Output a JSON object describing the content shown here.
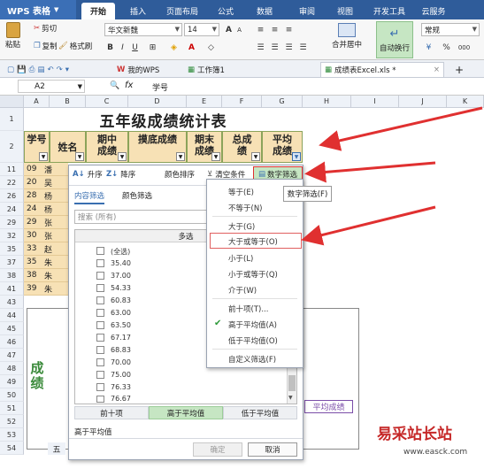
{
  "app": {
    "name": "WPS 表格"
  },
  "ribbon_tabs": [
    "开始",
    "插入",
    "页面布局",
    "公式",
    "数据",
    "审阅",
    "视图",
    "开发工具",
    "云服务"
  ],
  "toolbar": {
    "paste": "粘贴",
    "cut": "剪切",
    "copy": "复制",
    "format_painter": "格式刷",
    "font_name": "华文新魏",
    "font_size": "14",
    "merge_center": "合并居中",
    "wrap_text": "自动换行",
    "number_format": "常规",
    "percent": "%"
  },
  "doc_tabs": [
    {
      "label": "我的WPS"
    },
    {
      "label": "工作簿1"
    },
    {
      "label": "成绩表Excel.xls *"
    }
  ],
  "formula_bar": {
    "cell_ref": "A2",
    "fx": "fx",
    "content": "学号"
  },
  "columns": [
    "A",
    "B",
    "C",
    "D",
    "E",
    "F",
    "G",
    "H",
    "I",
    "J",
    "K"
  ],
  "rows": [
    "1",
    "2",
    "11",
    "22",
    "26",
    "24",
    "29",
    "32",
    "35",
    "37",
    "38",
    "41",
    "43",
    "44",
    "45",
    "46",
    "47",
    "48",
    "49",
    "50",
    "51",
    "52",
    "53",
    "54"
  ],
  "sheet": {
    "title": "五年级成绩统计表",
    "headers": [
      "学号",
      "姓名",
      "期中成绩",
      "摸底成绩",
      "期末成绩",
      "总成绩",
      "平均成绩"
    ],
    "data_rows": [
      {
        "id": "09",
        "name": "潘"
      },
      {
        "id": "20",
        "name": "吴"
      },
      {
        "id": "28",
        "name": "杨"
      },
      {
        "id": "24",
        "name": "杨"
      },
      {
        "id": "29",
        "name": "张"
      },
      {
        "id": "30",
        "name": "张"
      },
      {
        "id": "33",
        "name": "赵"
      },
      {
        "id": "35",
        "name": "朱"
      },
      {
        "id": "38",
        "name": "朱"
      },
      {
        "id": "39",
        "name": "朱"
      }
    ],
    "chart_vertical_label": "成绩",
    "chart_legend_label": "平均成绩"
  },
  "filter_popup": {
    "sort_asc": "升序",
    "sort_desc": "降序",
    "color_sort": "颜色排序",
    "clear_condition": "清空条件",
    "number_filter": "数字筛选",
    "tab_content": "内容筛选",
    "tab_color": "颜色筛选",
    "search_placeholder": "搜索 (所有)",
    "multi_select": "多选",
    "values": [
      "(全选)",
      "35.40",
      "37.00",
      "54.33",
      "60.83",
      "63.00",
      "63.50",
      "67.17",
      "68.83",
      "70.00",
      "75.00",
      "76.33",
      "76.67"
    ],
    "btn_top10": "前十项",
    "btn_above_avg": "高于平均值",
    "btn_below_avg": "低于平均值",
    "status": "高于平均值",
    "ok": "确定",
    "cancel": "取消"
  },
  "number_filter_menu": {
    "items": [
      "等于(E)",
      "不等于(N)",
      "大于(G)",
      "大于或等于(O)",
      "小于(L)",
      "小于或等于(Q)",
      "介于(W)",
      "前十项(T)...",
      "高于平均值(A)",
      "低于平均值(O)",
      "自定义筛选(F)"
    ],
    "checked_item": "高于平均值(A)",
    "highlighted_item": "大于或等于(O)"
  },
  "tooltip": "数字筛选(F)",
  "watermark": {
    "text": "易采站长站",
    "url": "www.easck.com"
  },
  "colors": {
    "header_fill": "#f7e1b5",
    "header_border": "#8ba35a",
    "arrow": "#e03030",
    "titlebar": "#2f5c9a",
    "highlight_green": "#c6e6c3"
  }
}
